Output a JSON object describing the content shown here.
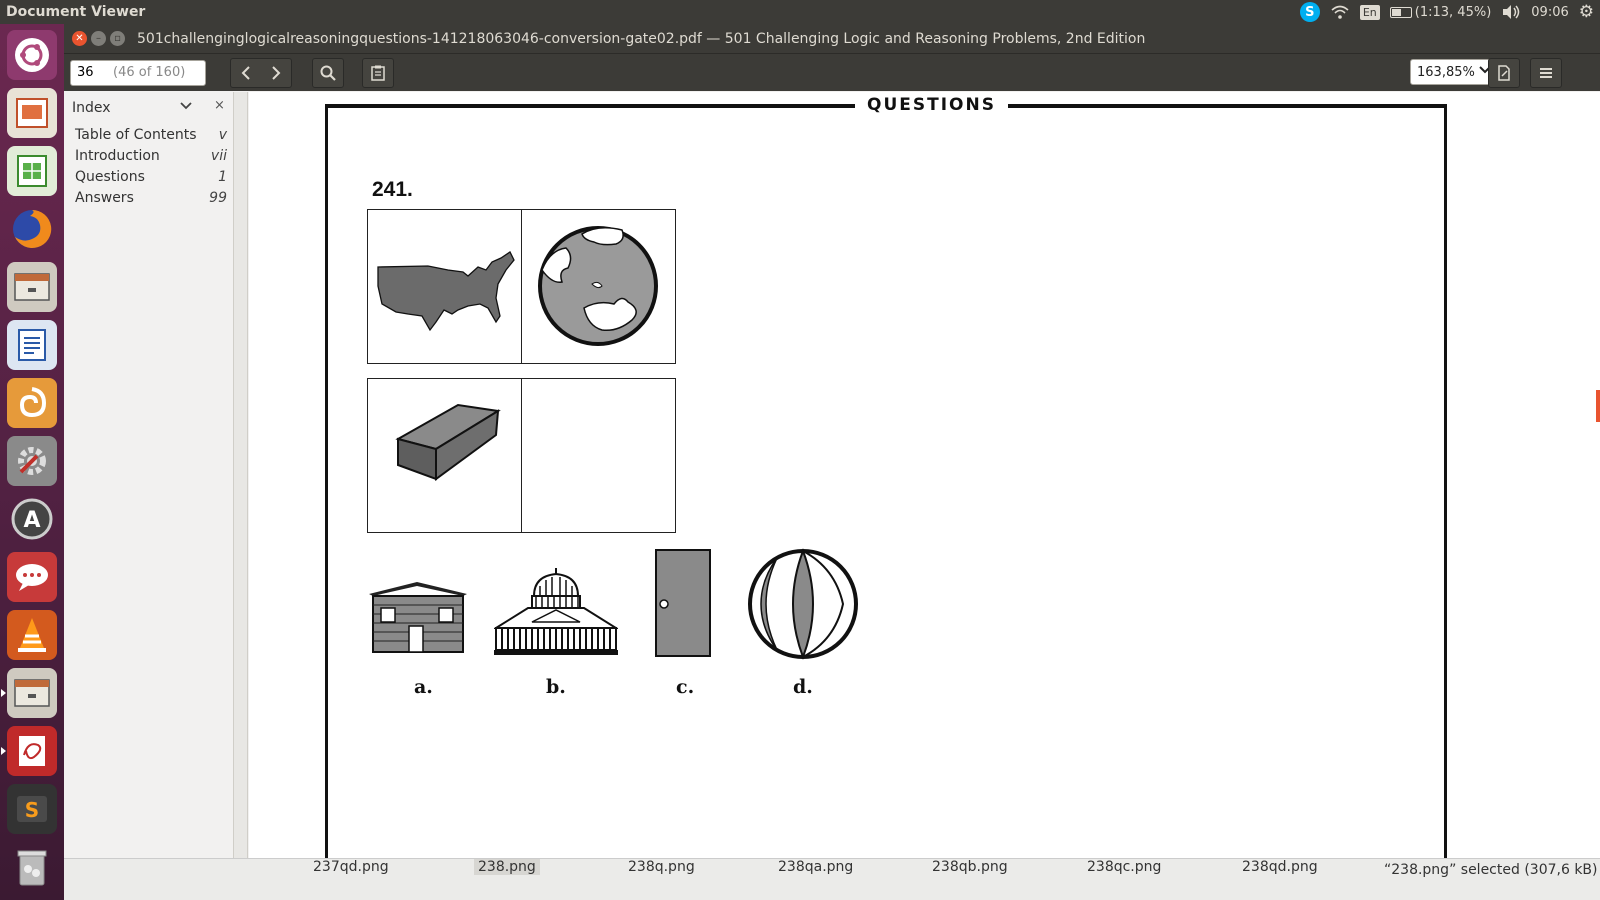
{
  "top_panel": {
    "app_name": "Document Viewer",
    "keyboard_layout": "En",
    "battery_text": "(1:13, 45%)",
    "clock": "09:06",
    "icons": [
      "skype-icon",
      "wifi-icon",
      "keyboard-icon",
      "battery-icon",
      "volume-icon",
      "gear-icon"
    ]
  },
  "launcher": {
    "icons": [
      "ubuntu-dash-icon",
      "impress-icon",
      "calc-icon",
      "firefox-icon",
      "files-icon",
      "writer-icon",
      "blender-icon",
      "settings-icon",
      "software-updater-icon",
      "chat-icon",
      "vlc-icon",
      "files-icon-2",
      "evince-icon",
      "sublime-icon",
      "trash-icon"
    ]
  },
  "window": {
    "title": "501challenginglogicalreasoningquestions-141218063046-conversion-gate02.pdf — 501 Challenging Logic and Reasoning Problems, 2nd Edition"
  },
  "toolbar": {
    "page_value": "36",
    "page_count": "(46 of 160)",
    "zoom": "163,85%",
    "icons": [
      "chevron-left-icon",
      "chevron-right-icon",
      "search-icon",
      "clipboard-icon",
      "annotation-icon",
      "hamburger-menu-icon"
    ]
  },
  "sidebar": {
    "title": "Index",
    "items": [
      {
        "label": "Table of Contents",
        "page": "v"
      },
      {
        "label": "Introduction",
        "page": "vii"
      },
      {
        "label": "Questions",
        "page": "1"
      },
      {
        "label": "Answers",
        "page": "99"
      }
    ]
  },
  "document": {
    "heading": "QUESTIONS",
    "question_number": "241.",
    "analogy_cells": [
      "usa-map-figure",
      "globe-figure",
      "brick-figure",
      "empty-answer-cell"
    ],
    "options": [
      {
        "label": "a.",
        "figure": "brick-house-figure"
      },
      {
        "label": "b.",
        "figure": "capitol-building-figure"
      },
      {
        "label": "c.",
        "figure": "door-figure"
      },
      {
        "label": "d.",
        "figure": "beach-ball-figure"
      }
    ]
  },
  "bottom_strip": {
    "files": [
      "237qd.png",
      "238.png",
      "238q.png",
      "238qa.png",
      "238qb.png",
      "238qc.png",
      "238qd.png"
    ],
    "status": "“238.png” selected  (307,6 kB)"
  },
  "colors": {
    "panel": "#3c3b37",
    "launcher": "#5a2348",
    "close_button": "#e9542f",
    "figure_fill": "#777777"
  }
}
